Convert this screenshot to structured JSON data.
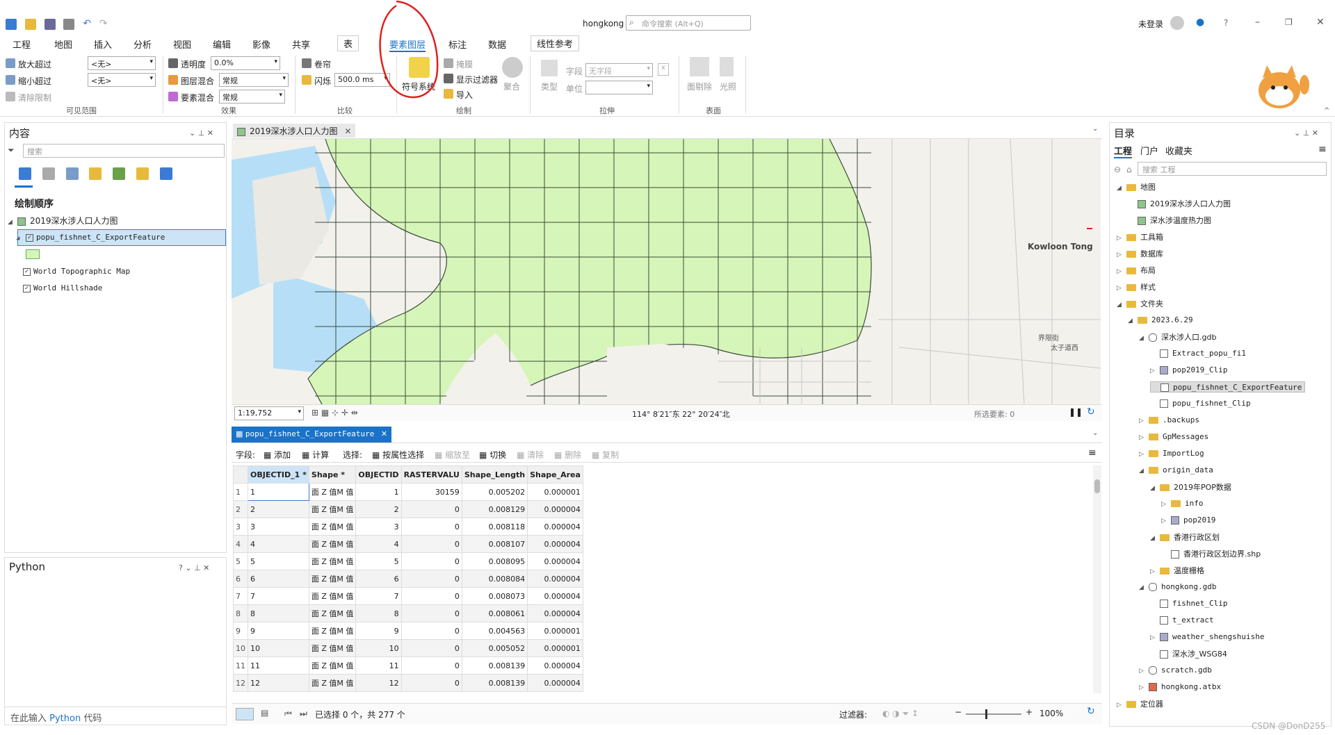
{
  "title": "hongkong",
  "search_placeholder": "命令搜索 (Alt+Q)",
  "user": "未登录",
  "menu": [
    "工程",
    "地图",
    "插入",
    "分析",
    "视图",
    "编辑",
    "影像",
    "共享",
    "表",
    "要素图层",
    "标注",
    "数据",
    "线性参考"
  ],
  "ribbon": {
    "zoom_in_beyond": "放大超过",
    "zoom_out_beyond": "缩小超过",
    "clear_limits": "清除限制",
    "zoom_in_value": "<无>",
    "zoom_out_value": "<无>",
    "visible_range": "可见范围",
    "transparency": "透明度",
    "transparency_value": "0.0%",
    "layer_blend": "图层混合",
    "layer_blend_value": "常规",
    "feature_blend": "要素混合",
    "feature_blend_value": "常规",
    "effects": "效果",
    "swipe": "卷帘",
    "flicker": "闪烁",
    "flicker_value": "500.0",
    "flicker_unit": "ms",
    "compare": "比较",
    "symbology": "符号系统",
    "mask": "掩膜",
    "show_filter": "显示过滤器",
    "import": "导入",
    "aggregate": "聚合",
    "drawing": "绘制",
    "type": "类型",
    "field": "字段",
    "field_value": "无字段",
    "unit": "单位",
    "extrude": "拉伸",
    "face_culling": "面剔除",
    "lighting": "光照",
    "surface": "表面"
  },
  "contents": {
    "title": "内容",
    "search_placeholder": "搜索",
    "draw_order": "绘制顺序",
    "map_name": "2019深水涉人口人力图",
    "layers": [
      "popu_fishnet_C_ExportFeature",
      "World Topographic Map",
      "World Hillshade"
    ]
  },
  "python": {
    "title": "Python",
    "prompt_prefix": "在此输入 ",
    "prompt_lang": "Python",
    "prompt_suffix": " 代码"
  },
  "map": {
    "tab": "2019深水涉人口人力图",
    "scale": "1:19,752",
    "coords": "114° 8′21″东  22° 20′24″北",
    "selected": "所选要素: 0",
    "label_kowloon_tong": "Kowloon Tong",
    "label_boundary": "界限街",
    "label_prince": "太子道西"
  },
  "attr": {
    "tab": "popu_fishnet_C_ExportFeature",
    "fields_label": "字段:",
    "add": "添加",
    "calc": "计算",
    "select_label": "选择:",
    "by_attr": "按属性选择",
    "zoom_to": "缩放至",
    "switch": "切换",
    "clear": "清除",
    "delete": "删除",
    "copy": "复制",
    "columns": [
      "OBJECTID_1 *",
      "Shape *",
      "OBJECTID",
      "RASTERVALU",
      "Shape_Length",
      "Shape_Area"
    ],
    "rows": [
      [
        "1",
        "1",
        "面 Z 值M 值",
        "1",
        "30159",
        "0.005202",
        "0.000001"
      ],
      [
        "2",
        "2",
        "面 Z 值M 值",
        "2",
        "0",
        "0.008129",
        "0.000004"
      ],
      [
        "3",
        "3",
        "面 Z 值M 值",
        "3",
        "0",
        "0.008118",
        "0.000004"
      ],
      [
        "4",
        "4",
        "面 Z 值M 值",
        "4",
        "0",
        "0.008107",
        "0.000004"
      ],
      [
        "5",
        "5",
        "面 Z 值M 值",
        "5",
        "0",
        "0.008095",
        "0.000004"
      ],
      [
        "6",
        "6",
        "面 Z 值M 值",
        "6",
        "0",
        "0.008084",
        "0.000004"
      ],
      [
        "7",
        "7",
        "面 Z 值M 值",
        "7",
        "0",
        "0.008073",
        "0.000004"
      ],
      [
        "8",
        "8",
        "面 Z 值M 值",
        "8",
        "0",
        "0.008061",
        "0.000004"
      ],
      [
        "9",
        "9",
        "面 Z 值M 值",
        "9",
        "0",
        "0.004563",
        "0.000001"
      ],
      [
        "10",
        "10",
        "面 Z 值M 值",
        "10",
        "0",
        "0.005052",
        "0.000001"
      ],
      [
        "11",
        "11",
        "面 Z 值M 值",
        "11",
        "0",
        "0.008139",
        "0.000004"
      ],
      [
        "12",
        "12",
        "面 Z 值M 值",
        "12",
        "0",
        "0.008139",
        "0.000004"
      ]
    ],
    "status": "已选择 0 个，共 277 个",
    "filter": "过滤器:",
    "zoom": "100%"
  },
  "catalog": {
    "title": "目录",
    "tabs": [
      "工程",
      "门户",
      "收藏夹"
    ],
    "search_placeholder": "搜索 工程",
    "items": [
      "地图",
      "2019深水涉人口人力图",
      "深水涉温度热力图",
      "工具箱",
      "数据库",
      "布局",
      "样式",
      "文件夹",
      "2023.6.29",
      "深水涉人口.gdb",
      "Extract_popu_fi1",
      "pop2019_Clip",
      "popu_fishnet_C_ExportFeature",
      "popu_fishnet_Clip",
      ".backups",
      "GpMessages",
      "ImportLog",
      "origin_data",
      "2019年POP数据",
      "info",
      "pop2019",
      "香港行政区划",
      "香港行政区划边界.shp",
      "温度栅格",
      "hongkong.gdb",
      "fishnet_Clip",
      "t_extract",
      "weather_shengshuishe",
      "深水涉_WSG84",
      "scratch.gdb",
      "hongkong.atbx",
      "定位器"
    ]
  },
  "watermark": "CSDN @DonD255",
  "colors": {
    "accent": "#1a73c8",
    "fishnet": "#d6f5b8",
    "water": "#b6dff7",
    "annotation": "#e02020"
  }
}
